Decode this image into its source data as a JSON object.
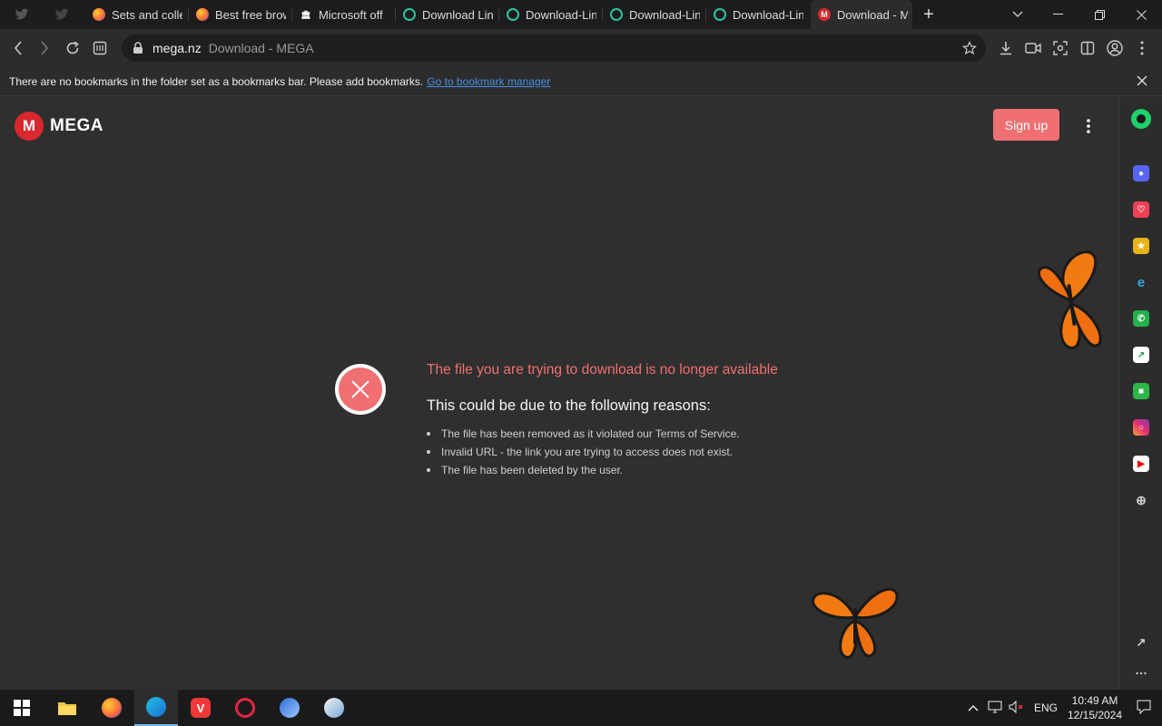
{
  "tabs": [
    {
      "label": "",
      "icon": "twitter-icon"
    },
    {
      "label": "",
      "icon": "twitter-icon"
    },
    {
      "label": "Sets and colle",
      "icon": "firefox-icon"
    },
    {
      "label": "Best free brow",
      "icon": "firefox-icon"
    },
    {
      "label": "Microsoft off",
      "icon": "bank-icon"
    },
    {
      "label": "Download Lin",
      "icon": "ring-icon"
    },
    {
      "label": "Download-Lin",
      "icon": "ring-icon"
    },
    {
      "label": "Download-Lin",
      "icon": "ring-icon"
    },
    {
      "label": "Download-Lin",
      "icon": "ring-icon"
    },
    {
      "label": "Download - M",
      "icon": "mega-icon",
      "active": true
    }
  ],
  "new_tab_label": "+",
  "address": {
    "host": "mega.nz",
    "title": "Download - MEGA"
  },
  "bookmark_bar": {
    "message": "There are no bookmarks in the folder set as a bookmarks bar. Please add bookmarks.",
    "link": "Go to bookmark manager"
  },
  "page": {
    "logo_letter": "M",
    "logo_text": "MEGA",
    "signup": "Sign up",
    "error_title": "The file you are trying to download is no longer available",
    "reasons_heading": "This could be due to the following reasons:",
    "reasons": [
      "The file has been removed as it violated our Terms of Service.",
      "Invalid URL - the link you are trying to access does not exist.",
      "The file has been deleted by the user."
    ]
  },
  "taskbar": {
    "language": "ENG",
    "time": "10:49 AM",
    "date": "12/15/2024"
  },
  "colors": {
    "accent": "#f07071",
    "mega_red": "#d9272e",
    "link": "#4a8fe7"
  }
}
